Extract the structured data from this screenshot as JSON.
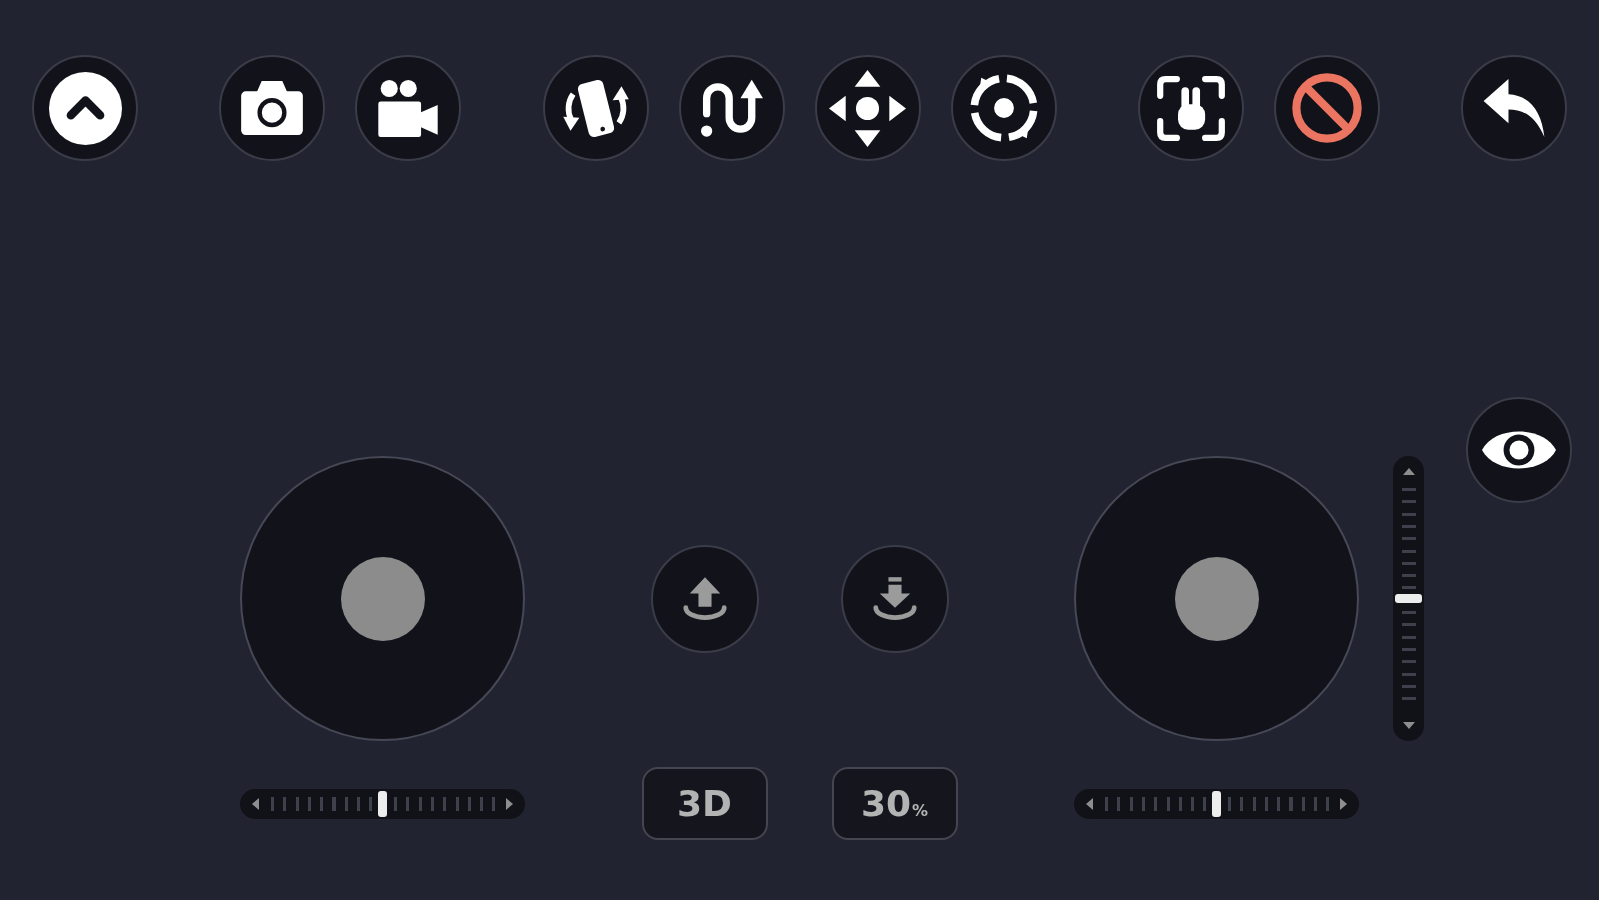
{
  "left_joystick": {
    "slider": {
      "level": 0.5
    }
  },
  "center_controls": {
    "mode_button": {
      "label": "3D"
    },
    "speed_button": {
      "value": "30",
      "unit": "%"
    }
  },
  "right_joystick": {
    "slider": {
      "level": 0.5
    }
  },
  "vertical_slider": {
    "level": 0.5
  }
}
